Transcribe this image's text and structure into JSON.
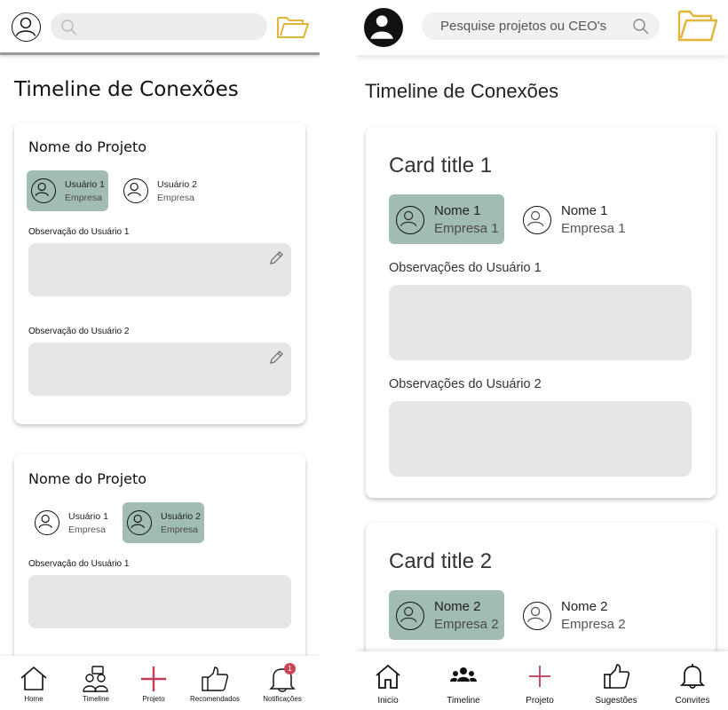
{
  "colors": {
    "accent_folder": "#e3b43a",
    "active_user_bg": "#a0bcb3",
    "project_plus": "#c13c58",
    "obs_box": "#e6e6e6",
    "badge": "#cc4455"
  },
  "left": {
    "header": {
      "search_placeholder": "",
      "search_icon": "search-icon",
      "folder_icon": "folder-icon"
    },
    "page_title": "Timeline de Conexões",
    "cards": [
      {
        "title": "Nome do Projeto",
        "users": [
          {
            "name": "Usuário 1",
            "company": "Empresa",
            "active": true
          },
          {
            "name": "Usuário 2",
            "company": "Empresa",
            "active": false
          }
        ],
        "observations": [
          {
            "label": "Observação do Usuário 1"
          },
          {
            "label": "Observação do Usuário 2"
          }
        ]
      },
      {
        "title": "Nome do Projeto",
        "users": [
          {
            "name": "Usuário 1",
            "company": "Empresa",
            "active": false
          },
          {
            "name": "Usuário 2",
            "company": "Empresa",
            "active": true
          }
        ],
        "observations": [
          {
            "label": "Observação do Usuário 1"
          }
        ]
      }
    ],
    "nav": [
      {
        "label": "Home",
        "icon": "home-icon"
      },
      {
        "label": "Timeline",
        "icon": "people-icon"
      },
      {
        "label": "Projeto",
        "icon": "plus-icon"
      },
      {
        "label": "Recomendados",
        "icon": "thumbs-up-icon"
      },
      {
        "label": "Notificações",
        "icon": "bell-icon",
        "badge": "1"
      }
    ]
  },
  "right": {
    "header": {
      "search_placeholder": "Pesquise projetos ou CEO's",
      "search_icon": "search-icon",
      "folder_icon": "folder-icon"
    },
    "page_title": "Timeline de Conexões",
    "cards": [
      {
        "title": "Card title 1",
        "users": [
          {
            "name": "Nome 1",
            "company": "Empresa 1",
            "active": true
          },
          {
            "name": "Nome 1",
            "company": "Empresa 1",
            "active": false
          }
        ],
        "observations": [
          {
            "label": "Observações do Usuário 1"
          },
          {
            "label": "Observações do Usuário 2"
          }
        ]
      },
      {
        "title": "Card title 2",
        "users": [
          {
            "name": "Nome 2",
            "company": "Empresa 2",
            "active": true
          },
          {
            "name": "Nome 2",
            "company": "Empresa 2",
            "active": false
          }
        ]
      }
    ],
    "nav": [
      {
        "label": "Inicio",
        "icon": "home-icon"
      },
      {
        "label": "Timeline",
        "icon": "people-icon"
      },
      {
        "label": "Projeto",
        "icon": "plus-icon"
      },
      {
        "label": "Sugestões",
        "icon": "thumbs-up-icon"
      },
      {
        "label": "Convites",
        "icon": "bell-icon"
      }
    ]
  }
}
